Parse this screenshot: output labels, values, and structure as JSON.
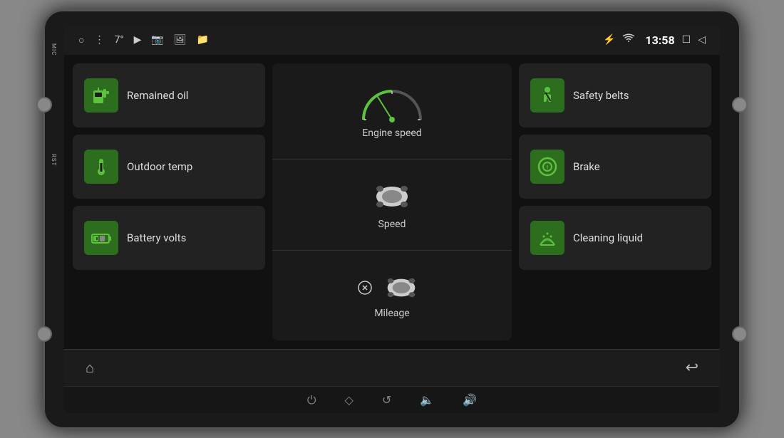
{
  "device": {
    "mic_label": "MIC",
    "rst_label": "RST"
  },
  "status_bar": {
    "temp": "7°",
    "time": "13:58",
    "icons": [
      "circle-icon",
      "dots-icon",
      "youtube-icon",
      "camera-icon",
      "photo-icon",
      "folder-icon"
    ]
  },
  "cards": {
    "remained_oil": "Remained oil",
    "outdoor_temp": "Outdoor temp",
    "battery_volts": "Battery volts",
    "safety_belts": "Safety belts",
    "brake": "Brake",
    "cleaning_liquid": "Cleaning liquid"
  },
  "center": {
    "engine_speed_label": "Engine speed",
    "speed_label": "Speed",
    "mileage_label": "Mileage"
  },
  "nav_bar": {
    "home_icon": "⌂",
    "back_icon": "↩"
  },
  "sys_bar": {
    "power_icon": "⏻",
    "home_icon": "⬡",
    "back_icon": "↺",
    "vol_down_icon": "🔈",
    "vol_up_icon": "🔊"
  }
}
